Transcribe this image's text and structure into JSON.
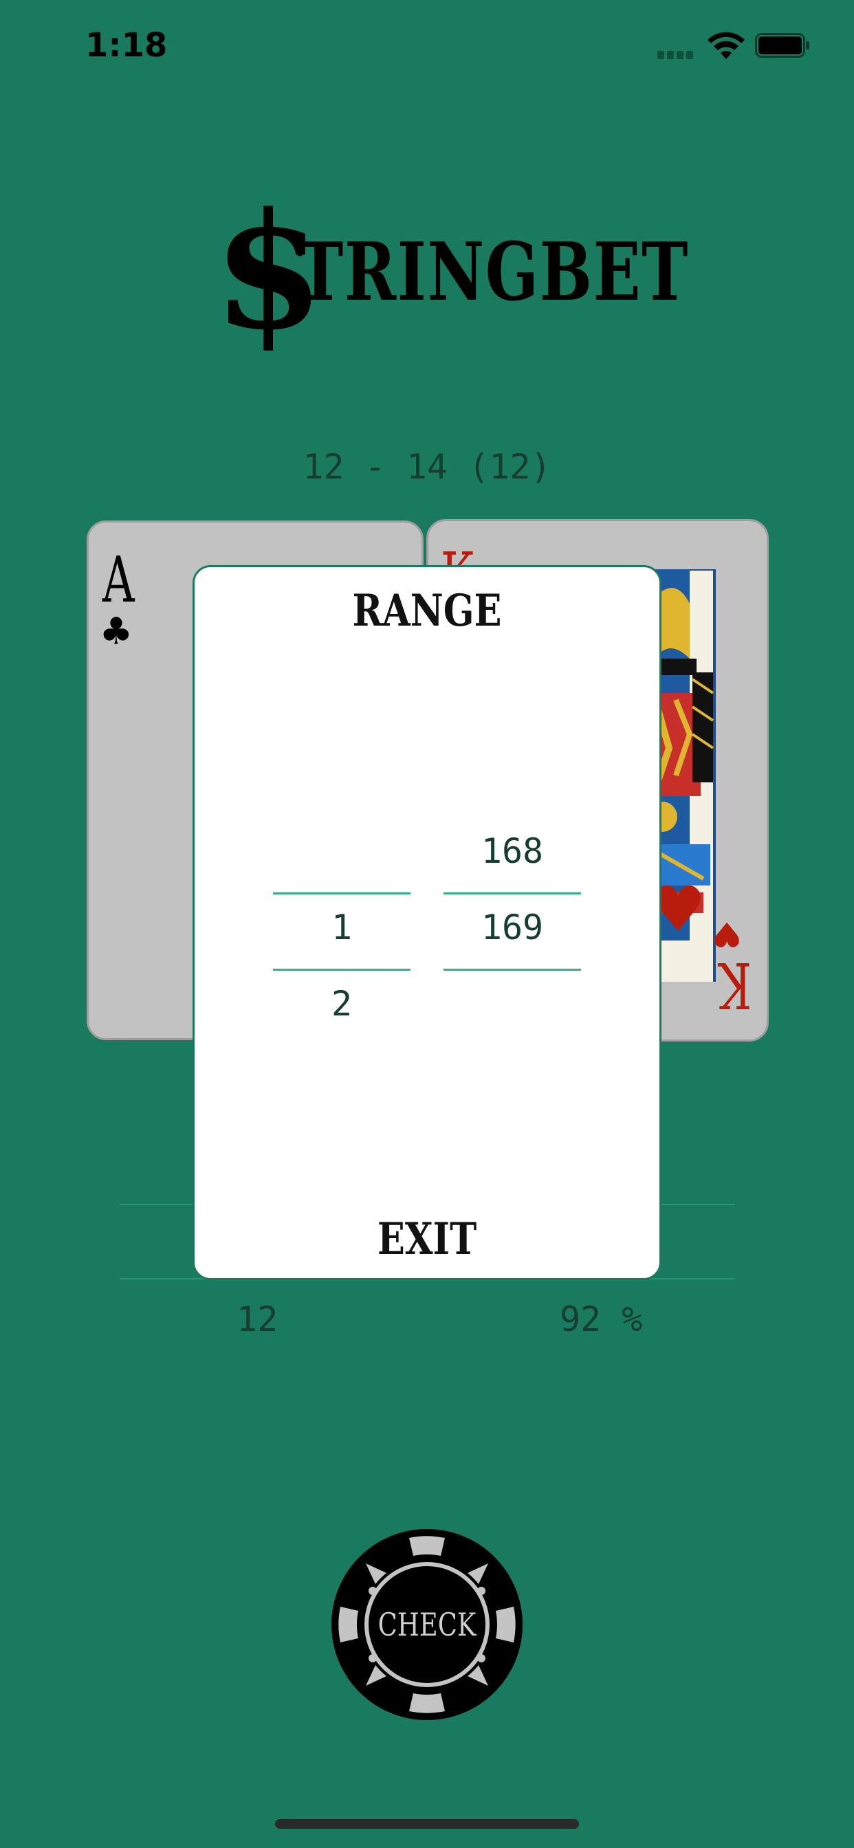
{
  "status_bar": {
    "time": "1:18",
    "signal_icon": "cellular-signal-icon",
    "wifi_icon": "wifi-icon",
    "battery_icon": "battery-icon"
  },
  "logo": {
    "dollar": "$",
    "text": "TRINGBET"
  },
  "range_display": "12 - 14 (12)",
  "cards": {
    "left": {
      "rank": "A",
      "suit": "♣",
      "suit_color": "#000000"
    },
    "right": {
      "rank": "K",
      "suit": "♥",
      "suit_color": "#b71c0c"
    }
  },
  "modal": {
    "title": "RANGE",
    "picker_left": {
      "above": "",
      "selected": "1",
      "below": "2"
    },
    "picker_right": {
      "above": "168",
      "selected": "169",
      "below": ""
    },
    "exit_label": "EXIT"
  },
  "stats": {
    "left": "12",
    "right": "92 %"
  },
  "check_button": {
    "label": "CHECK"
  },
  "colors": {
    "background": "#1a7a5f",
    "accent_line": "#33b38b",
    "text_dark": "#163d2f"
  }
}
